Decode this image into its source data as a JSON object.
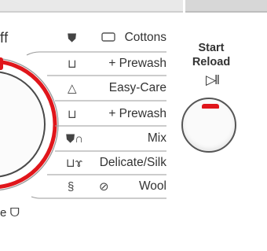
{
  "dial": {
    "off_label": "ff",
    "extra_label": "e",
    "accent_color": "#e0161b"
  },
  "programs": [
    {
      "label": "Cottons",
      "icon": "shirt-with-box-icon"
    },
    {
      "label": "+ Prewash",
      "icon": "basin-prewash-icon"
    },
    {
      "label": "Easy-Care",
      "icon": "shirt-on-hanger-icon"
    },
    {
      "label": "+ Prewash",
      "icon": "basin-prewash-icon"
    },
    {
      "label": "Mix",
      "icon": "shirt-and-trousers-icon"
    },
    {
      "label": "Delicate/Silk",
      "icon": "delicate-garment-icon"
    },
    {
      "label": "Wool",
      "icon": "wool-skein-icon"
    }
  ],
  "start": {
    "line1": "Start",
    "line2": "Reload",
    "playpause_symbol": "▷ǁ",
    "indicator_color": "#e0161b"
  }
}
